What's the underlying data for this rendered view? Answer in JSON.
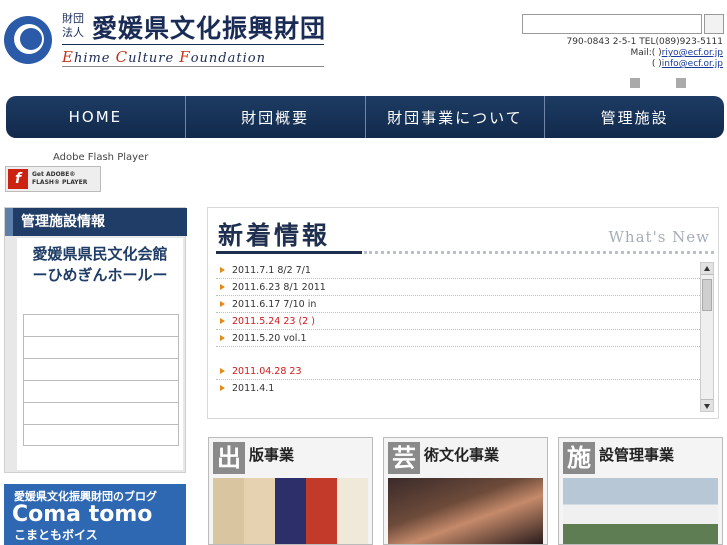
{
  "header": {
    "logo_small": "財団法人",
    "logo_title": "愛媛県文化振興財団",
    "logo_en_parts": [
      {
        "cap": "E",
        "rest": "hime "
      },
      {
        "cap": "C",
        "rest": "ulture "
      },
      {
        "cap": "F",
        "rest": "oundation"
      }
    ],
    "search_placeholder": "",
    "address_line_1": "790-0843        2-5-1 TEL(089)923-5111",
    "address_line_2_prefix": "Mail:(        )",
    "address_line_2_link": "riyo@ecf.or.jp",
    "address_line_3_prefix": "(        )",
    "address_line_3_link": "info@ecf.or.jp"
  },
  "nav": {
    "items": [
      {
        "label": "HOME"
      },
      {
        "label": "財団概要"
      },
      {
        "label": "財団事業について"
      },
      {
        "label": "管理施設"
      }
    ]
  },
  "flash": {
    "text": "Adobe Flash Player",
    "badge_icon": "f",
    "badge_line_1": "Get ADOBE®",
    "badge_line_2": "FLASH® PLAYER"
  },
  "sidebar": {
    "heading": "管理施設情報",
    "hall_line_1": "愛媛県県民文化会館",
    "hall_line_2": "ーひめぎんホールー"
  },
  "blog": {
    "line_1": "愛媛県文化振興財団のブログ",
    "line_2": "Coma tomo",
    "line_3": "こまともボイス"
  },
  "news": {
    "title": "新着情報",
    "title_en": "What's New",
    "items": [
      {
        "text": "2011.7.1 8/2                          7/1"
      },
      {
        "text": "2011.6.23 8/1                              2011"
      },
      {
        "text": "2011.6.17 7/10                          in"
      },
      {
        "text": "2011.5.24   23              (2  )"
      },
      {
        "text": "2011.5.20             vol.1"
      },
      {
        "text": "2011.04.28   23"
      },
      {
        "text": "2011.4.1"
      }
    ]
  },
  "banners": [
    {
      "kanji": "出",
      "title": "版事業"
    },
    {
      "kanji": "芸",
      "title": "術文化事業"
    },
    {
      "kanji": "施",
      "title": "設管理事業"
    }
  ]
}
